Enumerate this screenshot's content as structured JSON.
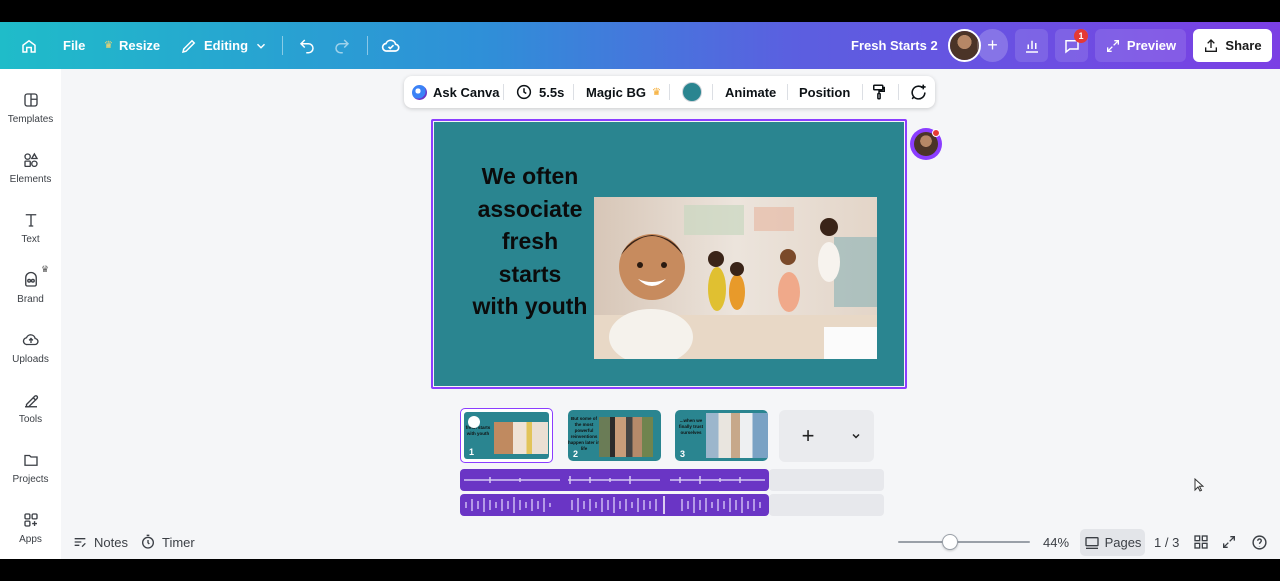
{
  "header": {
    "file_label": "File",
    "resize_label": "Resize",
    "editing_label": "Editing",
    "doc_title": "Fresh Starts 2",
    "comment_count": "1",
    "preview_label": "Preview",
    "share_label": "Share"
  },
  "toolbar": {
    "ask_canva": "Ask Canva",
    "duration": "5.5s",
    "magic_bg": "Magic BG",
    "color_swatch": "#2a8590",
    "animate": "Animate",
    "position": "Position"
  },
  "sidebar": {
    "items": [
      {
        "label": "Templates",
        "icon": "templates-icon"
      },
      {
        "label": "Elements",
        "icon": "elements-icon"
      },
      {
        "label": "Text",
        "icon": "text-icon"
      },
      {
        "label": "Brand",
        "icon": "brand-icon"
      },
      {
        "label": "Uploads",
        "icon": "uploads-icon"
      },
      {
        "label": "Tools",
        "icon": "tools-icon"
      },
      {
        "label": "Projects",
        "icon": "projects-icon"
      },
      {
        "label": "Apps",
        "icon": "apps-icon"
      }
    ]
  },
  "slide": {
    "heading_lines": [
      "We often",
      "associate",
      "fresh",
      "starts",
      "with youth"
    ],
    "background": "#2a8590"
  },
  "pages": {
    "thumbs": [
      {
        "num": "1",
        "text": "fresh starts with youth"
      },
      {
        "num": "2",
        "text": "But some of the most powerful reinventions happen later in life"
      },
      {
        "num": "3",
        "text": "...when we finally trust ourselves"
      }
    ]
  },
  "bottombar": {
    "notes": "Notes",
    "timer": "Timer",
    "zoom": "44%",
    "pages_label": "Pages",
    "page_count": "1 / 3"
  },
  "colors": {
    "accent": "#8b3dff",
    "audio_track": "#6a35c5"
  }
}
